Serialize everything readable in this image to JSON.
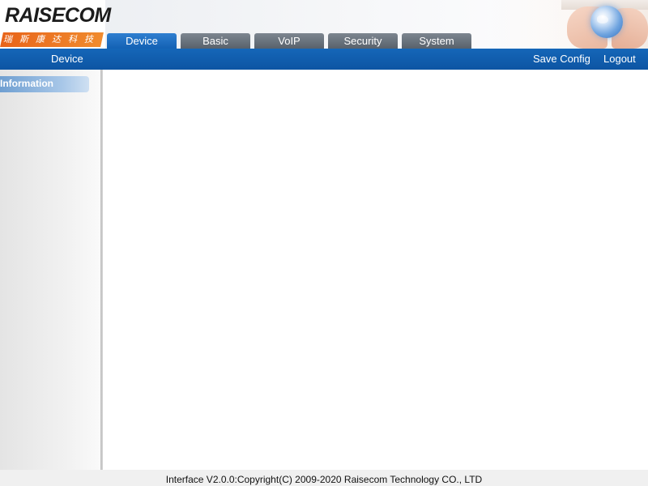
{
  "logo": {
    "wordmark": "RAISECOM",
    "tagline": "瑞斯康达科技"
  },
  "tabs": [
    {
      "label": "Device",
      "active": true
    },
    {
      "label": "Basic",
      "active": false
    },
    {
      "label": "VoIP",
      "active": false
    },
    {
      "label": "Security",
      "active": false
    },
    {
      "label": "System",
      "active": false
    }
  ],
  "navbar": {
    "section": "Device",
    "save_config": "Save Config",
    "logout": "Logout"
  },
  "sidebar": {
    "items": [
      {
        "label": "Information"
      }
    ]
  },
  "footer": {
    "text": "Interface V2.0.0:Copyright(C) 2009-2020 Raisecom Technology CO., LTD"
  },
  "colors": {
    "accent_blue": "#1361b4",
    "tab_gray": "#5f6872",
    "logo_orange": "#e8641a"
  },
  "icons": [
    "globe-in-hands-icon"
  ]
}
